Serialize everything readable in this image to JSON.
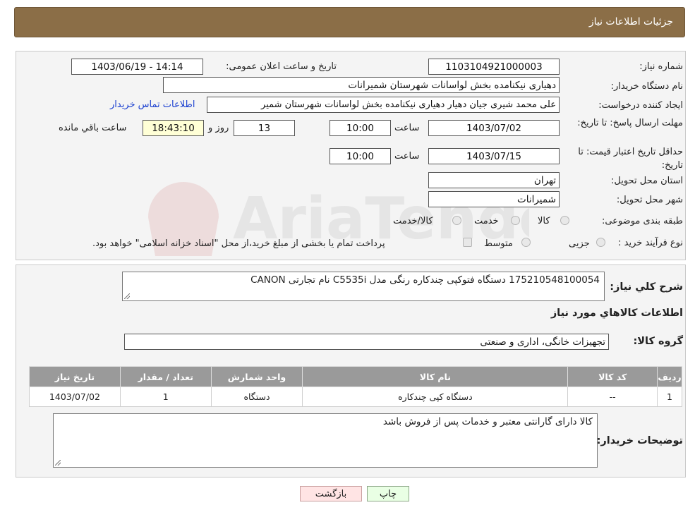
{
  "header": {
    "title": "جزئیات اطلاعات نیاز"
  },
  "watermark": {
    "text": "AriaTender.neT"
  },
  "form": {
    "need_number": {
      "label": "شماره نیاز:",
      "value": "1103104921000003"
    },
    "announce_datetime": {
      "label": "تاریخ و ساعت اعلان عمومی:",
      "value": "1403/06/19 - 14:14"
    },
    "buyer_org": {
      "label": "نام دستگاه خریدار:",
      "value": "دهیاری نیکنامده بخش لواسانات شهرستان شمیرانات"
    },
    "requester": {
      "label": "ایجاد کننده درخواست:",
      "value": "علی محمد شیری جیان دهیار دهیاری نیکنامده بخش لواسانات شهرستان شمیر"
    },
    "buyer_contact_link": "اطلاعات تماس خریدار",
    "reply_deadline": {
      "label": "مهلت ارسال پاسخ: تا تاریخ:",
      "date": "1403/07/02",
      "time_label": "ساعت",
      "time": "10:00",
      "days": "13",
      "days_label": "روز و",
      "remaining": "18:43:10",
      "remaining_label": "ساعت باقي مانده"
    },
    "price_validity": {
      "label": "حداقل تاریخ اعتبار قیمت: تا تاریخ:",
      "date": "1403/07/15",
      "time_label": "ساعت",
      "time": "10:00"
    },
    "delivery_province": {
      "label": "استان محل تحویل:",
      "value": "تهران"
    },
    "delivery_city": {
      "label": "شهر محل تحویل:",
      "value": "شمیرانات"
    },
    "category": {
      "label": "طبقه بندی موضوعی:",
      "options": [
        "کالا",
        "خدمت",
        "کالا/خدمت"
      ]
    },
    "purchase_type": {
      "label": "نوع فرآیند خرید :",
      "options": [
        "جزیی",
        "متوسط"
      ],
      "note": "پرداخت تمام یا بخشی از مبلغ خرید،از محل \"اسناد خزانه اسلامی\" خواهد بود."
    }
  },
  "summary": {
    "label": "شرح کلي نياز:",
    "value": "175210548100054 دستگاه فتوکپی چندکاره رنگی مدل C5535i نام تجارتی CANON"
  },
  "goods_section_title": "اطلاعات کالاهاي مورد نياز",
  "goods_group": {
    "label": "گروه کالا:",
    "value": "تجهیزات خانگی، اداری و صنعتی"
  },
  "table": {
    "headers": [
      "رديف",
      "کد کالا",
      "نام کالا",
      "واحد شمارش",
      "تعداد / مقدار",
      "تاريخ نياز"
    ],
    "rows": [
      [
        "1",
        "--",
        "دستگاه کپی چندکاره",
        "دستگاه",
        "1",
        "1403/07/02"
      ]
    ]
  },
  "buyer_notes": {
    "label": "توضیحات خریدار:",
    "value": "کالا دارای گارانتی معتبر و خدمات پس از فروش باشد"
  },
  "buttons": {
    "print": "چاپ",
    "back": "بازگشت"
  },
  "colors": {
    "header_bg": "#8b6e47",
    "back_button_bg": "#ffe4e4",
    "print_button_bg": "#e9ffe4",
    "link": "#1a3fd0"
  }
}
